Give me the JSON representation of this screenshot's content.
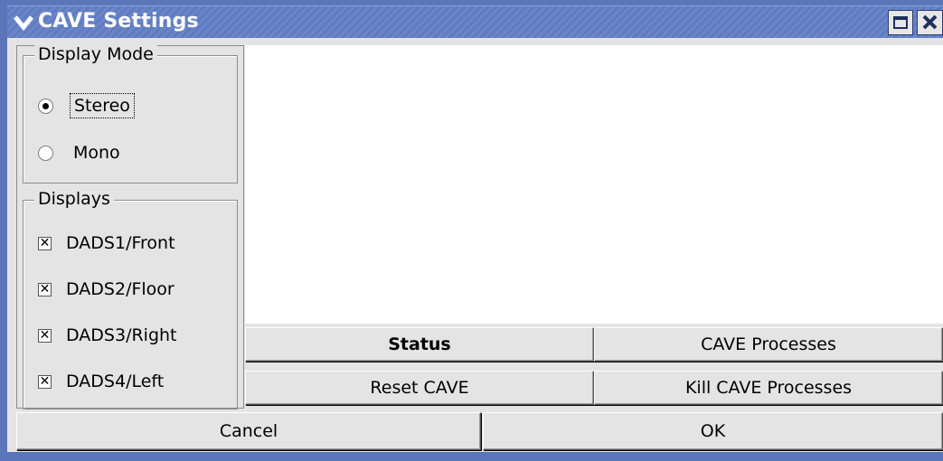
{
  "window": {
    "title": "CAVE Settings",
    "controls": [
      "chevron-down-icon",
      "maximize-icon",
      "close-icon"
    ]
  },
  "display_mode": {
    "title": "Display Mode",
    "options": [
      {
        "label": "Stereo",
        "selected": true
      },
      {
        "label": "Mono",
        "selected": false
      }
    ]
  },
  "displays": {
    "title": "Displays",
    "items": [
      {
        "label": "DADS1/Front",
        "checked": true
      },
      {
        "label": "DADS2/Floor",
        "checked": true
      },
      {
        "label": "DADS3/Right",
        "checked": true
      },
      {
        "label": "DADS4/Left",
        "checked": true
      }
    ]
  },
  "actions": {
    "status": "Status",
    "cave_processes": "CAVE Processes",
    "reset_cave": "Reset CAVE",
    "kill_cave_processes": "Kill CAVE Processes"
  },
  "footer": {
    "cancel": "Cancel",
    "ok": "OK"
  },
  "colors": {
    "titlebar": "#6a86c9",
    "window_frame": "#5a76b8",
    "panel_bg": "#e4e4e4",
    "content_bg": "#ffffff"
  }
}
